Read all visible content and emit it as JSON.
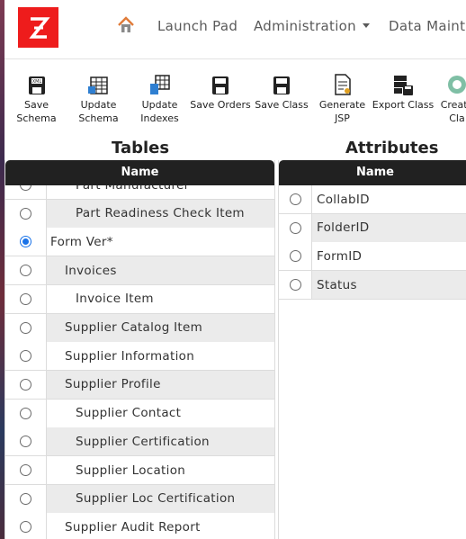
{
  "app": {
    "logo_letter": "Z",
    "brand_color": "#ee1c1c"
  },
  "nav": {
    "home_icon": "home-icon",
    "items": [
      {
        "label": "Launch Pad",
        "dropdown": false
      },
      {
        "label": "Administration",
        "dropdown": true
      },
      {
        "label": "Data Maint",
        "dropdown": false
      }
    ]
  },
  "toolbar": [
    {
      "label": "Save\nSchema",
      "icon": "save-xml-icon"
    },
    {
      "label": "Update\nSchema",
      "icon": "update-schema-icon"
    },
    {
      "label": "Update\nIndexes",
      "icon": "update-indexes-icon"
    },
    {
      "label": "Save Orders",
      "icon": "save-orders-icon"
    },
    {
      "label": "Save Class",
      "icon": "save-class-icon"
    },
    {
      "label": "Generate\nJSP",
      "icon": "generate-jsp-icon"
    },
    {
      "label": "Export Class",
      "icon": "export-class-icon"
    },
    {
      "label": "Create\nCla",
      "icon": "create-class-icon"
    }
  ],
  "tables": {
    "title": "Tables",
    "column": "Name",
    "rows": [
      {
        "name": "Part Manufacturer",
        "level": 2,
        "checked": false
      },
      {
        "name": "Part Readiness Check Item",
        "level": 2,
        "checked": false
      },
      {
        "name": "Form Ver*",
        "level": 0,
        "checked": true
      },
      {
        "name": "Invoices",
        "level": 1,
        "checked": false
      },
      {
        "name": "Invoice Item",
        "level": 2,
        "checked": false
      },
      {
        "name": "Supplier Catalog Item",
        "level": 1,
        "checked": false
      },
      {
        "name": "Supplier Information",
        "level": 1,
        "checked": false
      },
      {
        "name": "Supplier Profile",
        "level": 1,
        "checked": false
      },
      {
        "name": "Supplier Contact",
        "level": 2,
        "checked": false
      },
      {
        "name": "Supplier Certification",
        "level": 2,
        "checked": false
      },
      {
        "name": "Supplier Location",
        "level": 2,
        "checked": false
      },
      {
        "name": "Supplier Loc Certification",
        "level": 2,
        "checked": false
      },
      {
        "name": "Supplier Audit Report",
        "level": 1,
        "checked": false
      }
    ]
  },
  "attributes": {
    "title": "Attributes",
    "column": "Name",
    "rows": [
      {
        "name": "CollabID"
      },
      {
        "name": "FolderID"
      },
      {
        "name": "FormID"
      },
      {
        "name": "Status"
      }
    ]
  },
  "colors": {
    "header_bg": "#212121",
    "row_alt": "#ebebeb",
    "row_plain": "#ffffff",
    "radio_checked": "#1a73e8"
  }
}
